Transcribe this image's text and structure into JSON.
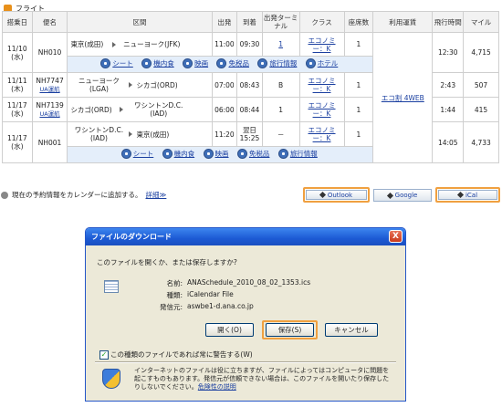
{
  "section_title": "フライト",
  "table": {
    "headers": [
      "搭乗日",
      "便名",
      "区間",
      "出発",
      "到着",
      "出発ターミナル",
      "クラス",
      "座席数",
      "利用運賃",
      "飛行時間",
      "マイル"
    ],
    "rows": [
      {
        "date": "11/10",
        "weekday": "(水)",
        "flight": "NH010",
        "from": "東京(成田)",
        "to": "ニューヨーク(JFK)",
        "dep": "11:00",
        "arr": "09:30",
        "term": "1",
        "cls": "エコノミー：K",
        "seats": "1",
        "time": "12:30",
        "miles": "4,715"
      },
      {
        "date": "11/11",
        "weekday": "(木)",
        "flight": "NH7747",
        "op": "UA運航",
        "from": "ニューヨーク(LGA)",
        "to": "シカゴ(ORD)",
        "dep": "07:00",
        "arr": "08:43",
        "term": "B",
        "cls": "エコノミー：K",
        "seats": "1",
        "time": "2:43",
        "miles": "507"
      },
      {
        "date": "11/17",
        "weekday": "(水)",
        "flight": "NH7139",
        "op": "UA運航",
        "from": "シカゴ(ORD)",
        "to": "ワシントンD.C.(IAD)",
        "dep": "06:00",
        "arr": "08:44",
        "term": "1",
        "cls": "エコノミー：K",
        "seats": "1",
        "time": "1:44",
        "miles": "415"
      },
      {
        "date": "11/17",
        "weekday": "(水)",
        "flight": "NH001",
        "from": "ワシントンD.C.(IAD)",
        "to": "東京(成田)",
        "dep": "11:20",
        "arr": "翌日 15:25",
        "term": "－",
        "cls": "エコノミー：K",
        "seats": "1",
        "time": "14:05",
        "miles": "4,733"
      }
    ],
    "fare": "エコ割 4WEB",
    "services_row1": [
      "シート",
      "機内食",
      "映画",
      "免税品",
      "旅行情報",
      "ホテル"
    ],
    "services_row4": [
      "シート",
      "機内食",
      "映画",
      "免税品",
      "旅行情報"
    ]
  },
  "calendar_text": "現在の予約情報をカレンダーに追加する。",
  "calendar_link": "詳細≫",
  "cal_buttons": {
    "outlook": "Outlook",
    "google": "Google",
    "ical": "iCal"
  },
  "dialog": {
    "title": "ファイルのダウンロード",
    "close": "X",
    "question": "このファイルを開くか、または保存しますか?",
    "name_label": "名前:",
    "name_value": "ANASchedule_2010_08_02_1353.ics",
    "type_label": "種類:",
    "type_value": "iCalendar File",
    "source_label": "発信元:",
    "source_value": "aswbe1-d.ana.co.jp",
    "open": "開く(O)",
    "save": "保存(S)",
    "cancel": "キャンセル",
    "checkbox": "この種類のファイルであれば常に警告する(W)",
    "warning": "インターネットのファイルは役に立ちますが、ファイルによってはコンピュータに問題を起こすものもあります。発信元が信頼できない場合は、このファイルを開いたり保存したりしないでください。",
    "risk_link": "危険性の説明"
  },
  "colors": {
    "accent": "#f0a040",
    "link": "#1a3fa0",
    "titlebar": "#1c5ad4"
  }
}
